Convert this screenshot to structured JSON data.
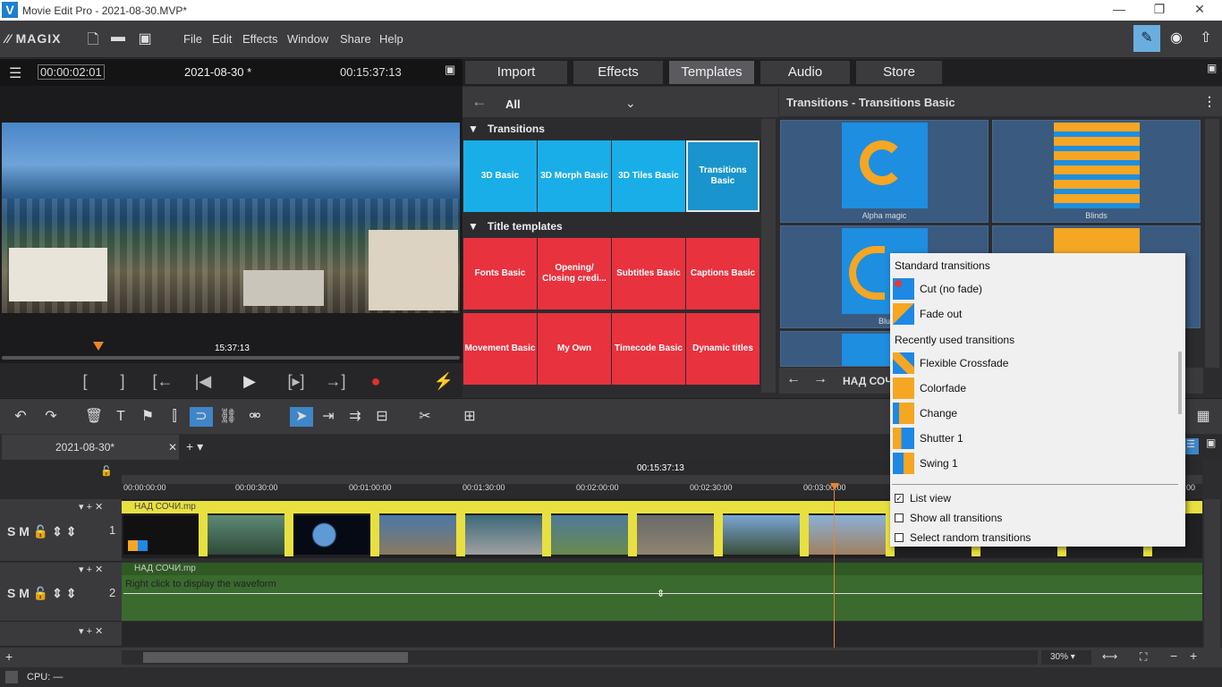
{
  "window": {
    "title": "Movie Edit Pro - 2021-08-30.MVP*",
    "min": "—",
    "restore": "❐",
    "close": "✕"
  },
  "menu": {
    "brand": "MAGIX",
    "items": [
      "File",
      "Edit",
      "Effects",
      "Window",
      "Share",
      "Help"
    ]
  },
  "preview": {
    "timecode": "00:00:02:01",
    "project": "2021-08-30 *",
    "duration": "00:15:37:13",
    "scrub_time": "15:37:13"
  },
  "tabs": [
    "Import",
    "Effects",
    "Templates",
    "Audio",
    "Store"
  ],
  "active_tab": "Templates",
  "library": {
    "filter": "All",
    "sections": [
      {
        "title": "Transitions",
        "tiles": [
          "3D Basic",
          "3D Morph Basic",
          "3D Tiles Basic",
          "Transitions Basic"
        ]
      },
      {
        "title": "Title templates",
        "tiles": [
          "Fonts Basic",
          "Opening/ Closing credi...",
          "Subtitles Basic",
          "Captions Basic",
          "Movement Basic",
          "My Own",
          "Timecode Basic",
          "Dynamic titles"
        ]
      }
    ]
  },
  "transitions_panel": {
    "title": "Transitions - Transitions Basic",
    "items": [
      "Alpha magic",
      "Blinds",
      "Blu"
    ],
    "footer": "НАД СОЧ"
  },
  "timeline": {
    "project_tab": "2021-08-30*",
    "ruler_time": "00:15:37:13",
    "ticks": [
      "00:00:00:00",
      "00:00:30:00",
      "00:01:00:00",
      "00:01:30:00",
      "00:02:00:00",
      "00:02:30:00",
      "00:03:00:00",
      "00"
    ],
    "track1_clip": "НАД СОЧИ.mp",
    "track2_clip": "НАД СОЧИ.mp",
    "waveform_hint": "Right click to display the waveform",
    "track_numbers": [
      "1",
      "2"
    ]
  },
  "popup": {
    "standard_header": "Standard transitions",
    "standard": [
      "Cut (no fade)",
      "Fade out"
    ],
    "recent_header": "Recently used transitions",
    "recent": [
      "Flexible Crossfade",
      "Colorfade",
      "Change",
      "Shutter 1",
      "Swing 1"
    ],
    "options": [
      {
        "label": "List view",
        "checked": true
      },
      {
        "label": "Show all transitions",
        "checked": false
      },
      {
        "label": "Select random transitions",
        "checked": false
      }
    ]
  },
  "zoom": "30%",
  "status": {
    "cpu": "CPU: —"
  }
}
